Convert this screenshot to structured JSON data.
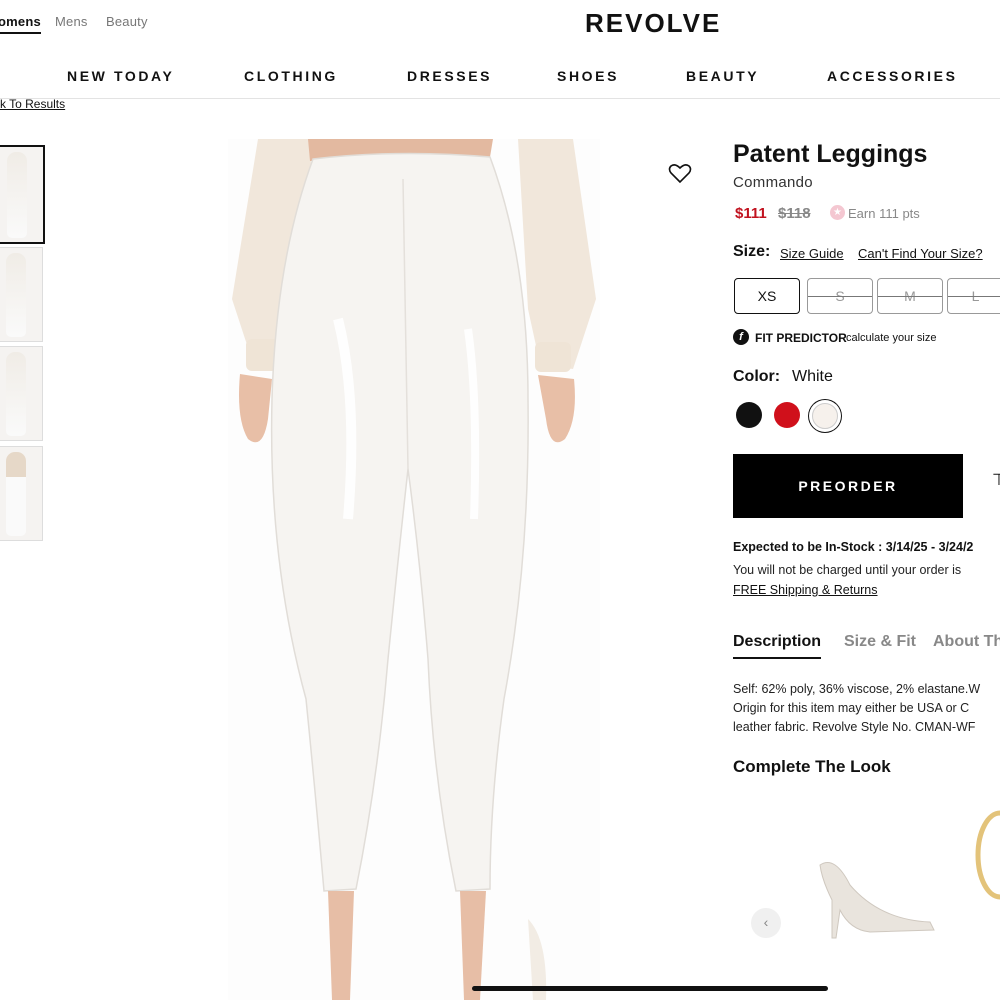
{
  "gender_nav": {
    "womens": "omens",
    "mens": "Mens",
    "beauty": "Beauty"
  },
  "logo": "REVOLVE",
  "main_nav": [
    "NEW TODAY",
    "CLOTHING",
    "DRESSES",
    "SHOES",
    "BEAUTY",
    "ACCESSORIES"
  ],
  "back_link": "ck To Results",
  "product": {
    "title": "Patent Leggings",
    "brand": "Commando",
    "price_sale": "$111",
    "price_original": "$118",
    "points": "Earn 111 pts",
    "size_label": "Size:",
    "size_guide": "Size Guide",
    "cant_find_size": "Can't Find Your Size?",
    "sizes": [
      {
        "label": "XS",
        "available": true,
        "selected": true
      },
      {
        "label": "S",
        "available": false,
        "selected": false
      },
      {
        "label": "M",
        "available": false,
        "selected": false
      },
      {
        "label": "L",
        "available": false,
        "selected": false
      }
    ],
    "fit_predictor_title": "FIT PREDICTOR",
    "fit_predictor_sub": "calculate your size",
    "color_label": "Color:",
    "color_value": "White",
    "swatches": [
      "#111111",
      "#d0101b",
      "#f6f1ec"
    ],
    "preorder_label": "PREORDER",
    "in_stock": "Expected to be In-Stock : 3/14/25 - 3/24/2",
    "charge_note": "You will not be charged until your order is",
    "shipping_link": "FREE Shipping & Returns"
  },
  "tabs": [
    "Description",
    "Size & Fit",
    "About Th"
  ],
  "description_lines": [
    "Self: 62% poly, 36% viscose, 2% elastane.W",
    "Origin for this item may either be USA or C",
    "leather fabric. Revolve Style No. CMAN-WF"
  ],
  "complete_the_look": "Complete The Look",
  "icons": {
    "heart": "heart-icon",
    "points": "star-icon",
    "fit": "fit-predictor-icon",
    "carousel_prev": "chevron-left-icon"
  },
  "colors": {
    "accent": "#c1121f",
    "primary": "#000000"
  }
}
